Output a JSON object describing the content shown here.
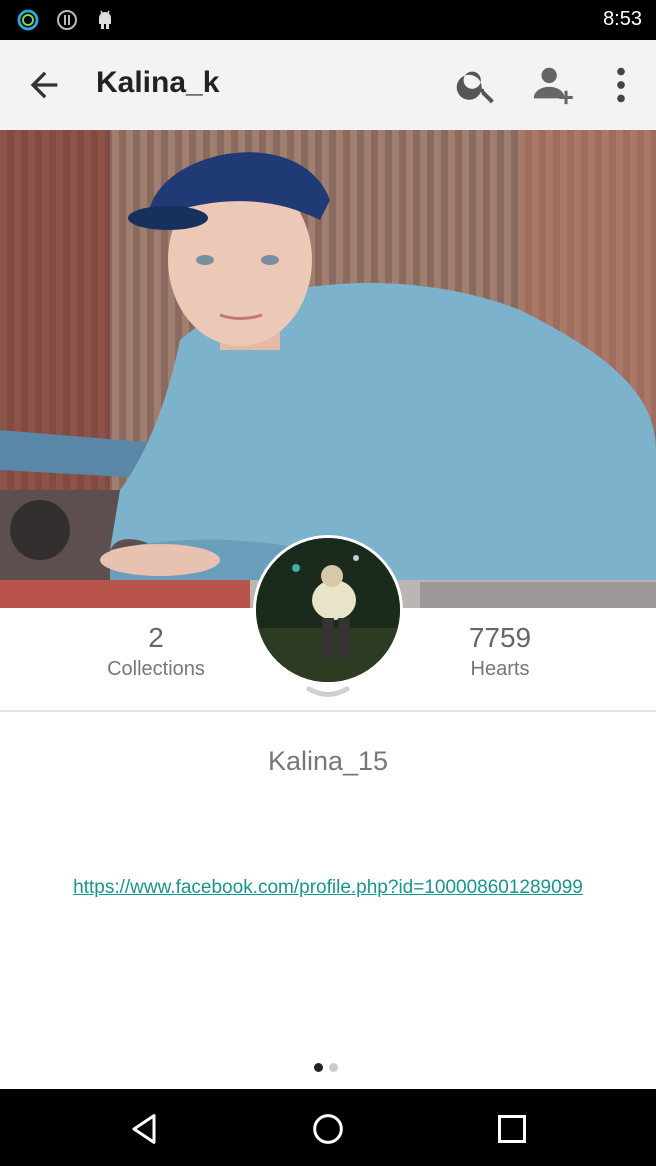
{
  "status_bar": {
    "time": "8:53",
    "icons": [
      "ring-status-icon",
      "info-status-icon",
      "android-status-icon"
    ]
  },
  "app_bar": {
    "title": "Kalina_k",
    "actions": [
      "back-icon",
      "search-icon",
      "add-person-icon",
      "more-vert-icon"
    ]
  },
  "profile": {
    "collections_count": "2",
    "collections_label": "Collections",
    "hearts_count": "7759",
    "hearts_label": "Hearts",
    "username": "Kalina_15",
    "link": "https://www.facebook.com/profile.php?id=100008601289099"
  },
  "pager": {
    "page_count": 2,
    "current_page": 1
  },
  "nav_bar": {
    "buttons": [
      "back-nav-icon",
      "home-nav-icon",
      "recents-nav-icon"
    ]
  },
  "colors": {
    "link": "#18958c",
    "app_bar_bg": "#f3f3f3",
    "text_muted": "#777777"
  }
}
